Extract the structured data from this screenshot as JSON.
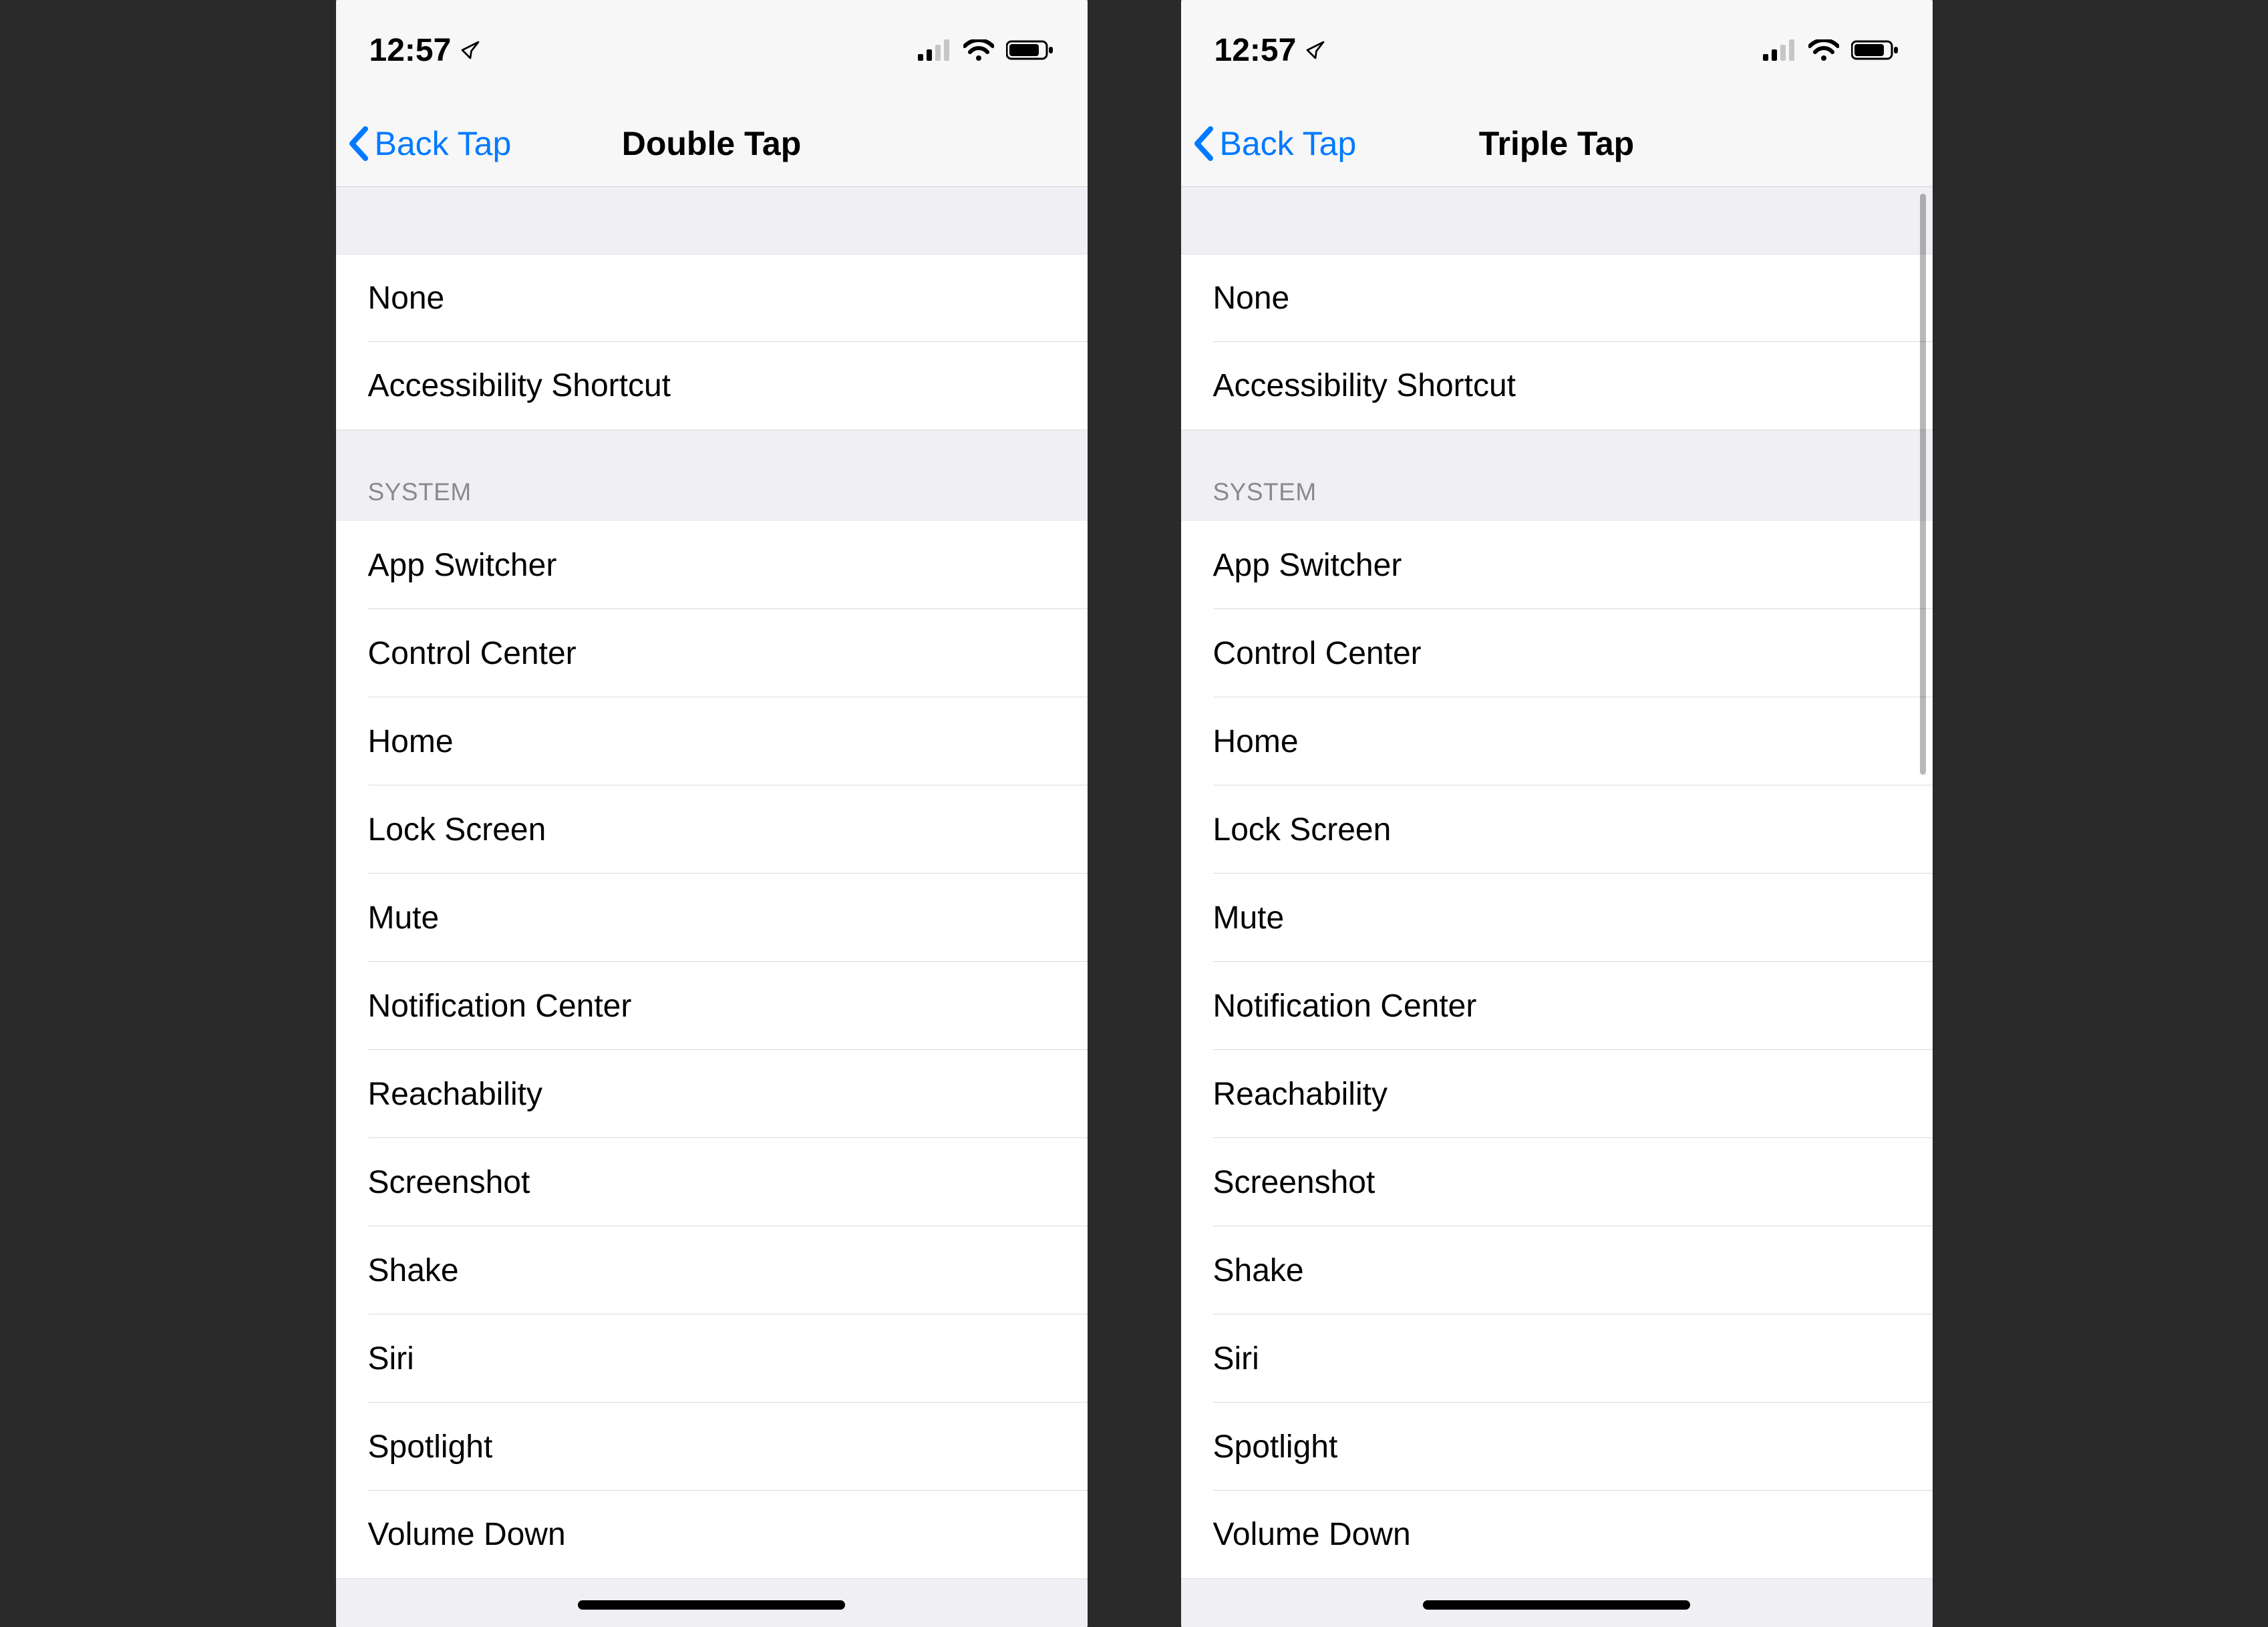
{
  "status": {
    "time": "12:57",
    "location_active": true,
    "cell_bars": 2,
    "cell_total": 4,
    "wifi": true,
    "battery_percent": 80
  },
  "screens": {
    "left": {
      "nav_back": "Back Tap",
      "nav_title": "Double Tap",
      "show_scrollbar": false
    },
    "right": {
      "nav_back": "Back Tap",
      "nav_title": "Triple Tap",
      "show_scrollbar": true
    }
  },
  "sections": [
    {
      "header": null,
      "items": [
        "None",
        "Accessibility Shortcut"
      ]
    },
    {
      "header": "SYSTEM",
      "items": [
        "App Switcher",
        "Control Center",
        "Home",
        "Lock Screen",
        "Mute",
        "Notification Center",
        "Reachability",
        "Screenshot",
        "Shake",
        "Siri",
        "Spotlight",
        "Volume Down"
      ]
    }
  ]
}
